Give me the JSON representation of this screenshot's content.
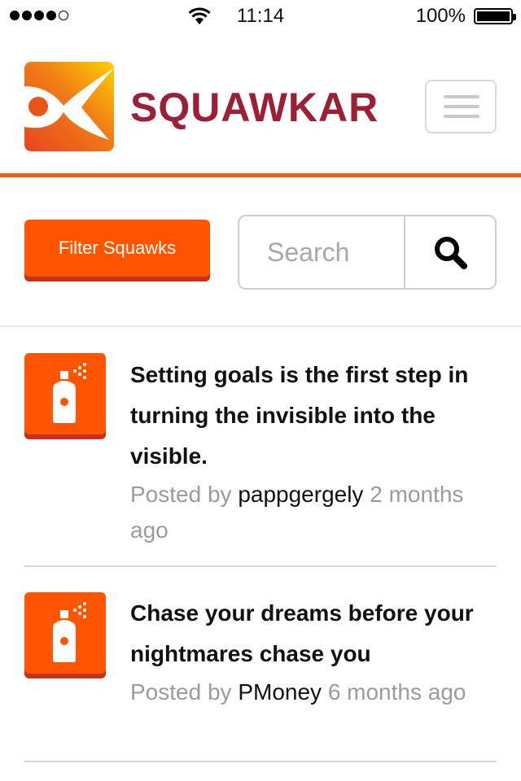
{
  "status_bar": {
    "time": "11:14",
    "battery_percent": "100%",
    "signal_bars": 4,
    "signal_total": 5,
    "battery_level": 1.0
  },
  "header": {
    "brand": "SQUAWKAR",
    "logo_icon": "squawkar-logo",
    "menu_icon": "hamburger-icon"
  },
  "toolbar": {
    "filter_label": "Filter Squawks",
    "search_placeholder": "Search",
    "search_icon": "search-icon"
  },
  "posts": [
    {
      "title": "Setting goals is the first step in turning the invisible into the visible.",
      "posted_by": "Posted by",
      "author": "pappgergely",
      "time": "2 months ago",
      "icon": "spray-can-icon"
    },
    {
      "title": "Chase your dreams before your nightmares chase you",
      "posted_by": "Posted by",
      "author": "PMoney",
      "time": "6 months ago",
      "icon": "spray-can-icon"
    }
  ],
  "colors": {
    "brand": "#9d1f35",
    "accent": "#ff5500",
    "accent_dark": "#c5311c",
    "header_rule": "#f05b17"
  }
}
